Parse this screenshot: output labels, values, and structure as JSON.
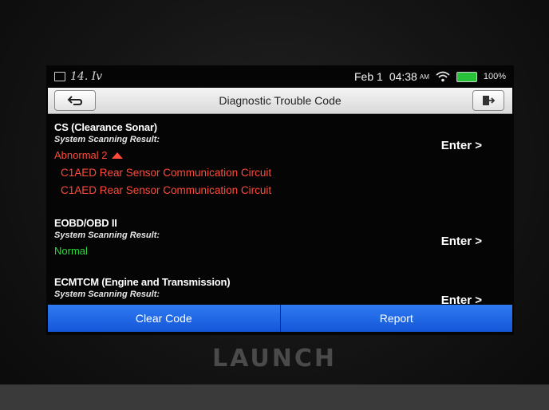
{
  "status_bar": {
    "scribble": "14. Iv",
    "date": "Feb 1",
    "time": "04:38",
    "ampm": "AM",
    "battery": "100%"
  },
  "header": {
    "title": "Diagnostic Trouble Code"
  },
  "systems": [
    {
      "name": "CS (Clearance Sonar)",
      "scan_label": "System Scanning Result:",
      "status": "Abnormal 2",
      "codes": [
        "C1AED Rear Sensor Communication Circuit",
        "C1AED Rear Sensor Communication Circuit"
      ],
      "enter_label": "Enter >"
    },
    {
      "name": "EOBD/OBD II",
      "scan_label": "System Scanning Result:",
      "status": "Normal",
      "enter_label": "Enter >"
    },
    {
      "name": "ECMTCM (Engine and Transmission)",
      "scan_label": "System Scanning Result:",
      "enter_label": "Enter >"
    }
  ],
  "footer": {
    "clear_label": "Clear Code",
    "report_label": "Report"
  },
  "device": {
    "brand": "LAUNCH"
  },
  "colors": {
    "abnormal": "#ff4a3a",
    "normal": "#2bdc3c",
    "action_blue": "#1f66e6"
  }
}
